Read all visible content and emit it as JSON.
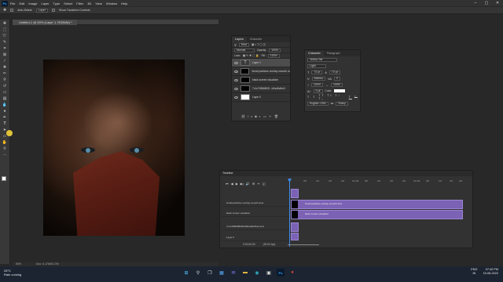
{
  "menubar": {
    "logo": "Ps",
    "items": [
      "File",
      "Edit",
      "Image",
      "Layer",
      "Type",
      "Select",
      "Filter",
      "3D",
      "View",
      "Window",
      "Help"
    ]
  },
  "options": {
    "auto_select_label": "Auto-Select:",
    "auto_select_value": "Layer",
    "transform_label": "Show Transform Controls"
  },
  "document": {
    "tab_title": "Untitled-1 @ 50% (Layer 1, RGB/8#) *",
    "zoom": "50%",
    "doc_size": "Doc: 6.17M/6.17M"
  },
  "layers_panel": {
    "tabs": [
      "Layers",
      "Channels"
    ],
    "kind_label": "Kind",
    "blend_mode": "Normal",
    "opacity_label": "Opacity:",
    "opacity_value": "100%",
    "lock_label": "Lock:",
    "fill_label": "Fill:",
    "fill_value": "100%",
    "layers": [
      {
        "name": "Layer 1",
        "thumb": "text",
        "selected": true
      },
      {
        "name": "Small particles overlay smooth dust",
        "thumb": "black",
        "selected": false
      },
      {
        "name": "black screen visualizer",
        "thumb": "black",
        "selected": false
      },
      {
        "name": "7c1e78f84883f...b2ad6cfbe3",
        "thumb": "black",
        "selected": false
      },
      {
        "name": "Layer 0",
        "thumb": "white",
        "selected": false
      }
    ]
  },
  "character_panel": {
    "tabs": [
      "Character",
      "Paragraph"
    ],
    "font_family": "Yellow Tail",
    "font_style": "Light",
    "size": "72 pt",
    "leading": "72 pt",
    "kerning": "Metrics",
    "tracking": "0",
    "vscale": "100%",
    "hscale": "100%",
    "baseline": "0 pt",
    "color_label": "Color:",
    "language": "English: USA",
    "aa": "Sharp"
  },
  "timeline": {
    "title": "Timeline",
    "timecode": "0:00:00:00",
    "fps": "(30.00 fps)",
    "ruler": [
      "05f",
      "10f",
      "15f",
      "20f",
      "01:00f",
      "05f",
      "10f",
      "15f",
      "20f",
      "02:00f",
      "05f",
      "10f",
      "15f",
      "20f",
      "03:00f"
    ],
    "tracks": [
      {
        "label": "Small particles overlay smooth dust",
        "clip": "Small particles overlay smooth dust"
      },
      {
        "label": "black screen visualizer",
        "clip": "black screen visualizer"
      },
      {
        "label": "7c1e78f84883f0c69b2ad6cfbe3.el.8",
        "clip": ""
      },
      {
        "label": "Layer 0",
        "clip": ""
      }
    ]
  },
  "taskbar": {
    "temp": "28°C",
    "weather": "Rain coming",
    "lang1": "ENG",
    "lang2": "IN",
    "time": "07:40 PM",
    "date": "15-08-2022"
  },
  "colors": {
    "accent": "#3d8be8",
    "clip": "#7c62b5",
    "panel": "#323232"
  }
}
